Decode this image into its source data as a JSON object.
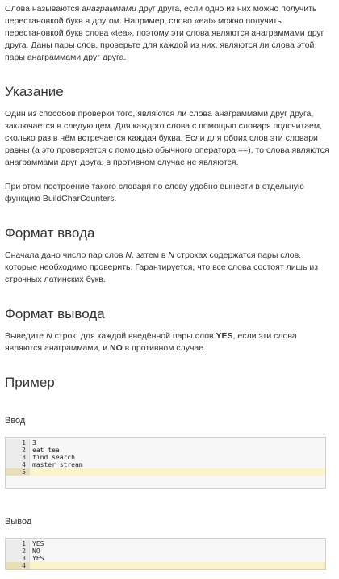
{
  "intro": {
    "t1": "Слова называются ",
    "em1": "анаграммами",
    "t2": " друг друга, если одно из них можно получить перестановкой букв в другом. Например, слово «eat» можно получить перестановкой букв слова «tea», поэтому эти слова являются анаграммами друг друга. Даны пары слов, проверьте для каждой из них, являются ли слова этой пары анаграммами друг друга."
  },
  "hint": {
    "title": "Указание",
    "p1": "Один из способов проверки того, являются ли слова анаграммами друг друга, заключается в следующем. Для каждого слова с помощью словаря подсчитаем, сколько раз в нём встречается каждая буква. Если для обоих слов эти словари равны (а это проверяется с помощью обычного оператора ==), то слова являются анаграммами друг друга, в противном случае не являются.",
    "p2": "При этом построение такого словаря по слову удобно вынести в отдельную функцию BuildCharCounters."
  },
  "input_format": {
    "title": "Формат ввода",
    "t1": "Сначала дано число пар слов ",
    "em1": "N",
    "t2": ", затем в ",
    "em2": "N",
    "t3": " строках содержатся пары слов, которые необходимо проверить. Гарантируется, что все слова состоят лишь из строчных латинских букв."
  },
  "output_format": {
    "title": "Формат вывода",
    "t1": "Выведите ",
    "em1": "N",
    "t2": " строк: для каждой введённой пары слов ",
    "b1": "YES",
    "t3": ", если эти слова являются анаграммами, и ",
    "b2": "NO",
    "t4": " в противном случае."
  },
  "example": {
    "title": "Пример",
    "input_label": "Ввод",
    "input_lines": [
      {
        "n": "1",
        "text": "3"
      },
      {
        "n": "2",
        "text": "eat tea"
      },
      {
        "n": "3",
        "text": "find search"
      },
      {
        "n": "4",
        "text": "master stream"
      },
      {
        "n": "5",
        "text": ""
      }
    ],
    "output_label": "Вывод",
    "output_lines": [
      {
        "n": "1",
        "text": "YES"
      },
      {
        "n": "2",
        "text": "NO"
      },
      {
        "n": "3",
        "text": "YES"
      },
      {
        "n": "4",
        "text": ""
      }
    ]
  }
}
